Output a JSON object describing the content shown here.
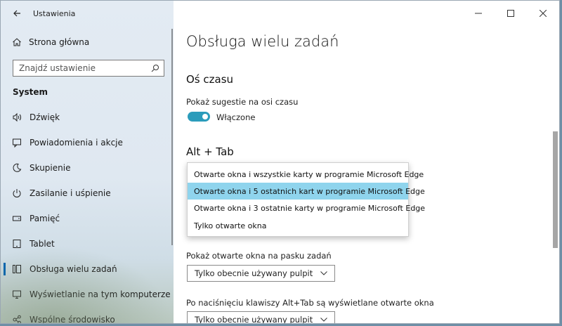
{
  "window": {
    "title": "Ustawienia"
  },
  "sidebar": {
    "home_label": "Strona główna",
    "search_placeholder": "Znajdź ustawienie",
    "category": "System",
    "items": [
      {
        "label": "Dźwięk",
        "icon": "speaker-icon"
      },
      {
        "label": "Powiadomienia i akcje",
        "icon": "message-icon"
      },
      {
        "label": "Skupienie",
        "icon": "moon-icon"
      },
      {
        "label": "Zasilanie i uśpienie",
        "icon": "power-icon"
      },
      {
        "label": "Pamięć",
        "icon": "drive-icon"
      },
      {
        "label": "Tablet",
        "icon": "tablet-icon"
      },
      {
        "label": "Obsługa wielu zadań",
        "icon": "multitask-icon",
        "active": true
      },
      {
        "label": "Wyświetlanie na tym komputerze",
        "icon": "project-icon"
      },
      {
        "label": "Wspólne środowisko",
        "icon": "share-icon"
      }
    ]
  },
  "main": {
    "page_title": "Obsługa wielu zadań",
    "timeline": {
      "heading": "Oś czasu",
      "suggestions_label": "Pokaż sugestie na osi czasu",
      "toggle_state": "Włączone",
      "toggle_on": true
    },
    "alttab": {
      "heading": "Alt + Tab",
      "options": [
        "Otwarte okna i wszystkie karty w programie Microsoft Edge",
        "Otwarte okna i 5 ostatnich kart w programie Microsoft Edge",
        "Otwarte okna i 3 ostatnie karty w programie Microsoft Edge",
        "Tylko otwarte okna"
      ],
      "selected_index": 1
    },
    "taskbar": {
      "label": "Pokaż otwarte okna na pasku zadań",
      "value": "Tylko obecnie używany pulpit"
    },
    "alttab_desktops": {
      "label": "Po naciśnięciu klawiszy Alt+Tab są wyświetlane otwarte okna",
      "value": "Tylko obecnie używany pulpit"
    }
  },
  "colors": {
    "accent": "#0063b1",
    "toggle": "#2b9cbb",
    "highlight": "#8fd4ed"
  }
}
